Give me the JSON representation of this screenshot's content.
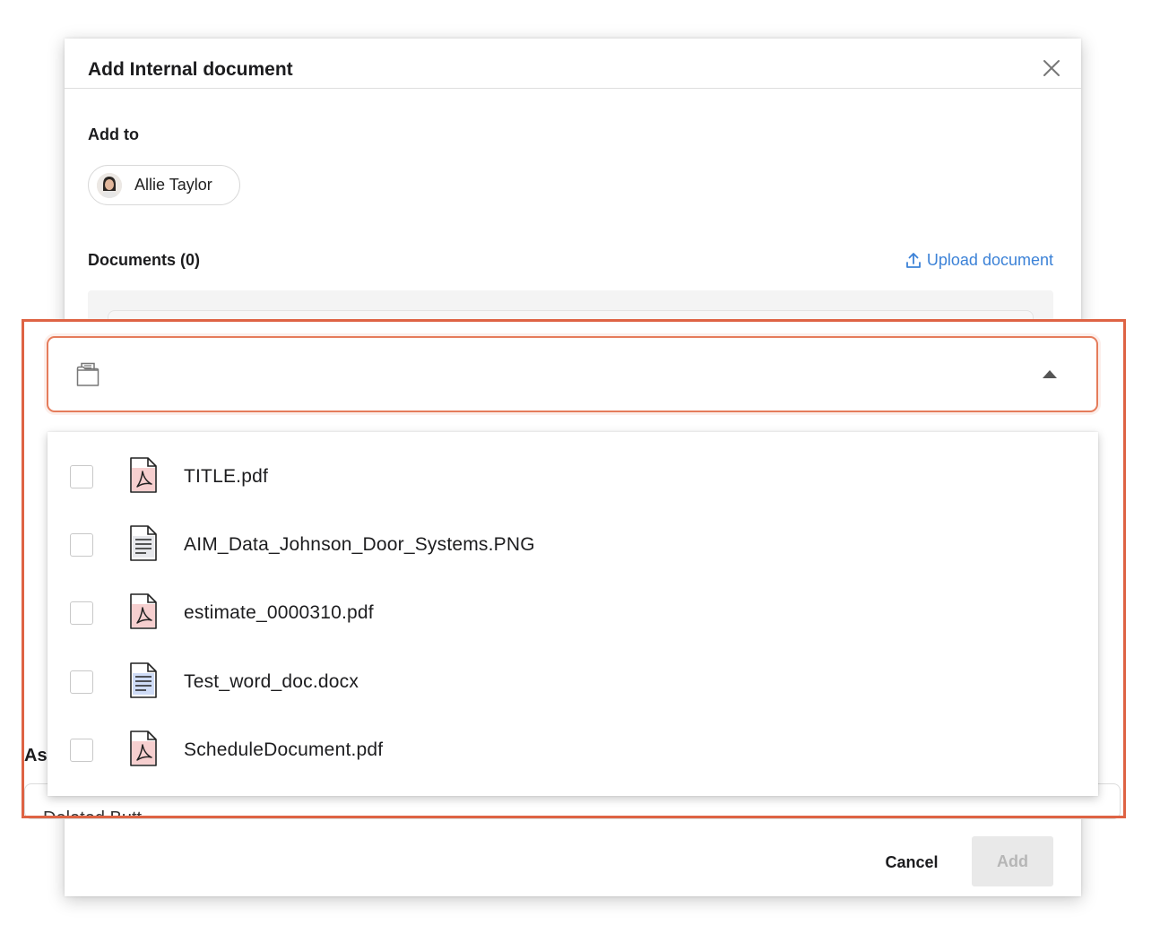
{
  "modal": {
    "title": "Add Internal document",
    "add_to_label": "Add to",
    "recipient": {
      "name": "Allie Taylor"
    },
    "documents_label": "Documents (0)",
    "upload_label": "Upload document",
    "cancel_label": "Cancel",
    "add_label": "Add"
  },
  "background_stub": {
    "label_fragment": "As",
    "field_fragment": "Deleted Butt"
  },
  "dropdown": {
    "selected_value": "",
    "options": [
      {
        "name": "TITLE.pdf",
        "type": "pdf",
        "checked": false
      },
      {
        "name": "AIM_Data_Johnson_Door_Systems.PNG",
        "type": "image",
        "checked": false
      },
      {
        "name": "estimate_0000310.pdf",
        "type": "pdf",
        "checked": false
      },
      {
        "name": "Test_word_doc.docx",
        "type": "word",
        "checked": false
      },
      {
        "name": "ScheduleDocument.pdf",
        "type": "pdf",
        "checked": false
      }
    ]
  },
  "colors": {
    "accent_link": "#3c82d7",
    "highlight_border": "#de6344",
    "select_border": "#e57c5b",
    "pdf_fill": "#f6cfcf",
    "word_fill": "#cfdcf7"
  }
}
